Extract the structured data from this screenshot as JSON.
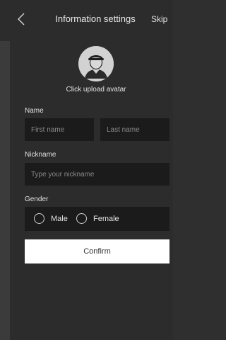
{
  "header": {
    "title": "Information settings",
    "skip_label": "Skip",
    "back_icon": "chevron-left-icon"
  },
  "avatar": {
    "icon": "user-avatar-icon",
    "upload_label": "Click upload avatar"
  },
  "name_section": {
    "label": "Name",
    "first_name_placeholder": "First name",
    "last_name_placeholder": "Last name"
  },
  "nickname_section": {
    "label": "Nickname",
    "placeholder": "Type your nickname"
  },
  "gender_section": {
    "label": "Gender",
    "options": [
      {
        "label": "Male",
        "selected": false
      },
      {
        "label": "Female",
        "selected": false
      }
    ]
  },
  "confirm_label": "Confirm",
  "colors": {
    "background": "#2c2c2c",
    "input_background": "#1b1b1b",
    "button_background": "#ffffff"
  }
}
